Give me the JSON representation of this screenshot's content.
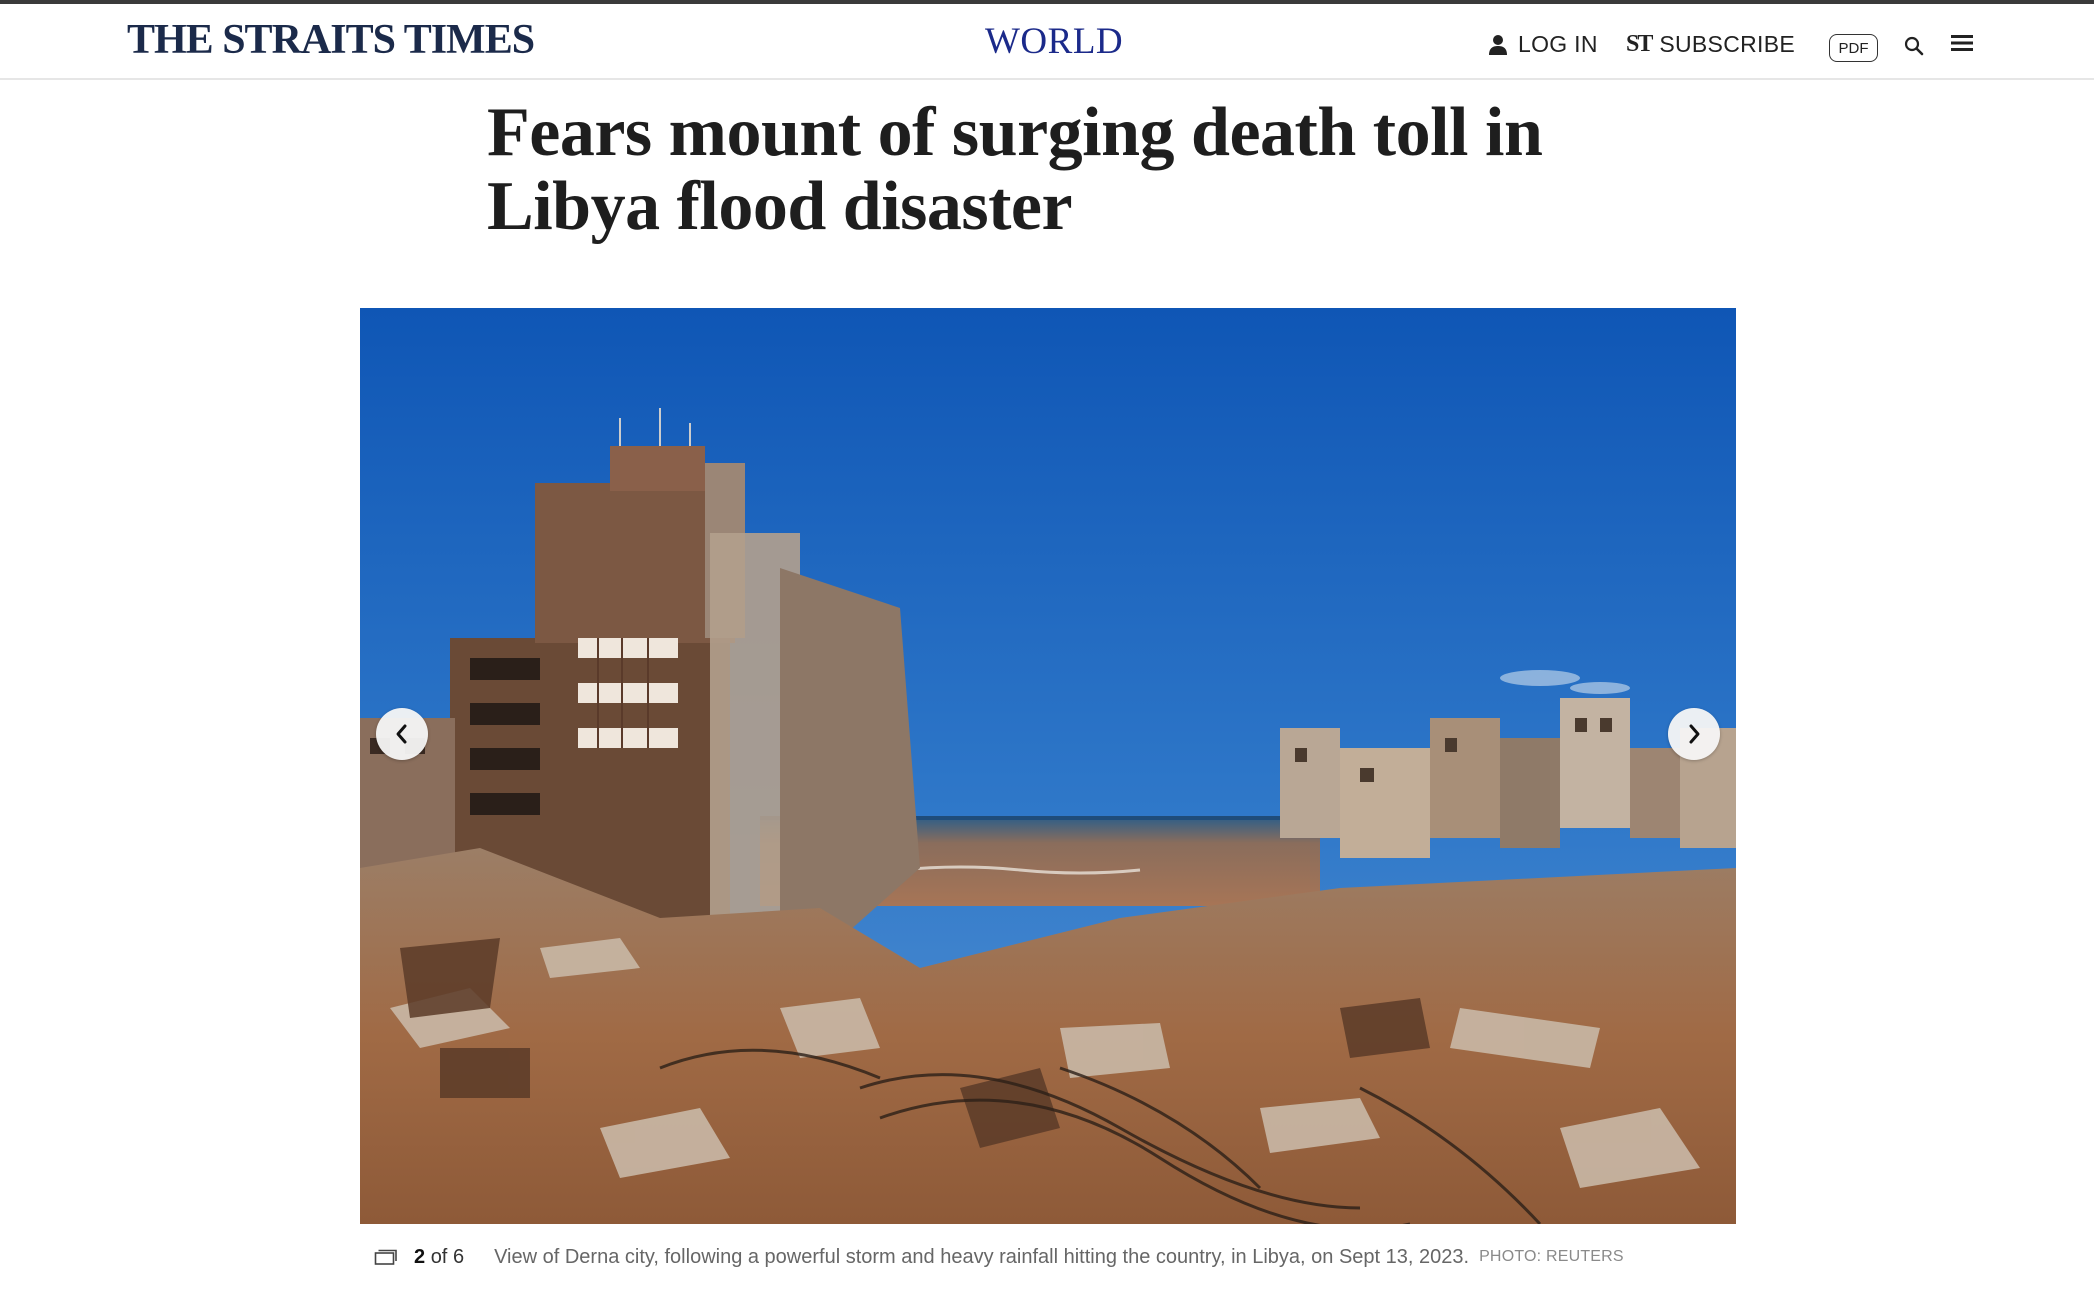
{
  "header": {
    "brand": "THE STRAITS TIMES",
    "section": "WORLD",
    "login_label": "LOG IN",
    "subscribe_mark": "ST",
    "subscribe_label": "SUBSCRIBE",
    "pdf_label": "PDF"
  },
  "article": {
    "headline": "Fears mount of surging death toll in Libya flood disaster"
  },
  "gallery": {
    "current": "2",
    "of_label": "of",
    "total": "6",
    "caption": "View of Derna city, following a powerful storm and heavy rainfall hitting the country, in Libya, on Sept 13, 2023.",
    "credit": "PHOTO: REUTERS"
  },
  "colors": {
    "brand": "#1b2a4a",
    "section": "#1b2a8a",
    "sky": "#1b63b8",
    "sea": "#8a6a55",
    "mud": "#a86f45"
  },
  "icons": {
    "login": "user-icon",
    "search": "search-icon",
    "menu": "hamburger-menu-icon",
    "prev": "chevron-left-icon",
    "next": "chevron-right-icon",
    "gallery": "gallery-icon"
  }
}
